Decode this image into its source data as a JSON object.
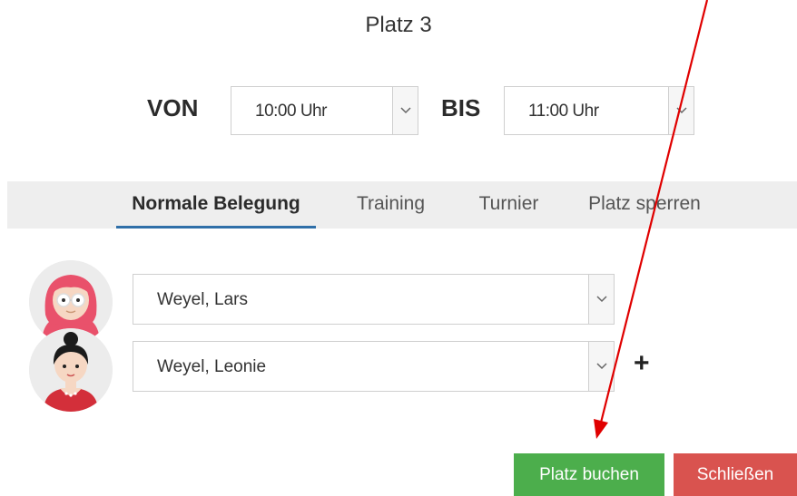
{
  "header": {
    "title": "Platz 3"
  },
  "time": {
    "from_label": "VON",
    "from_value": "10:00 Uhr",
    "to_label": "BIS",
    "to_value": "11:00 Uhr"
  },
  "tabs": [
    {
      "label": "Normale Belegung",
      "active": true
    },
    {
      "label": "Training",
      "active": false
    },
    {
      "label": "Turnier",
      "active": false
    },
    {
      "label": "Platz sperren",
      "active": false
    }
  ],
  "players": [
    {
      "name": "Weyel, Lars",
      "avatar": "female-avatar-pink-hair-glasses"
    },
    {
      "name": "Weyel, Leonie",
      "avatar": "female-avatar-black-hair-bun"
    }
  ],
  "add_player_symbol": "+",
  "buttons": {
    "book_label": "Platz buchen",
    "close_label": "Schließen"
  },
  "colors": {
    "book": "#4cae4c",
    "close": "#d9534f",
    "active_tab_underline": "#2f6fa8",
    "annotation_arrow": "#e00000"
  }
}
